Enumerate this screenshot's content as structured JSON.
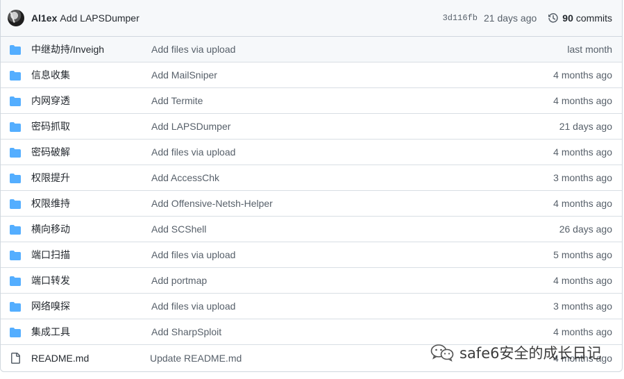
{
  "commit": {
    "author": "Al1ex",
    "message": "Add LAPSDumper",
    "sha": "3d116fb",
    "age": "21 days ago",
    "commit_count": "90",
    "commits_label": "commits"
  },
  "files": [
    {
      "type": "folder",
      "name": "中继劫持/Inveigh",
      "message": "Add files via upload",
      "age": "last month"
    },
    {
      "type": "folder",
      "name": "信息收集",
      "message": "Add MailSniper",
      "age": "4 months ago"
    },
    {
      "type": "folder",
      "name": "内网穿透",
      "message": "Add Termite",
      "age": "4 months ago"
    },
    {
      "type": "folder",
      "name": "密码抓取",
      "message": "Add LAPSDumper",
      "age": "21 days ago"
    },
    {
      "type": "folder",
      "name": "密码破解",
      "message": "Add files via upload",
      "age": "4 months ago"
    },
    {
      "type": "folder",
      "name": "权限提升",
      "message": "Add AccessChk",
      "age": "3 months ago"
    },
    {
      "type": "folder",
      "name": "权限维持",
      "message": "Add Offensive-Netsh-Helper",
      "age": "4 months ago"
    },
    {
      "type": "folder",
      "name": "横向移动",
      "message": "Add SCShell",
      "age": "26 days ago"
    },
    {
      "type": "folder",
      "name": "端口扫描",
      "message": "Add files via upload",
      "age": "5 months ago"
    },
    {
      "type": "folder",
      "name": "端口转发",
      "message": "Add portmap",
      "age": "4 months ago"
    },
    {
      "type": "folder",
      "name": "网络嗅探",
      "message": "Add files via upload",
      "age": "3 months ago"
    },
    {
      "type": "folder",
      "name": "集成工具",
      "message": "Add SharpSploit",
      "age": "4 months ago"
    },
    {
      "type": "file",
      "name": "README.md",
      "message": "Update README.md",
      "age": "4 months ago"
    }
  ],
  "watermark": "safe6安全的成长日记",
  "colors": {
    "folder": "#54aeff",
    "file_icon": "#57606a",
    "border": "#d0d7de",
    "header_bg": "#f6f8fa"
  },
  "icons": {
    "folder": "folder-icon",
    "file": "file-icon",
    "history": "history-icon",
    "wechat": "wechat-icon"
  }
}
